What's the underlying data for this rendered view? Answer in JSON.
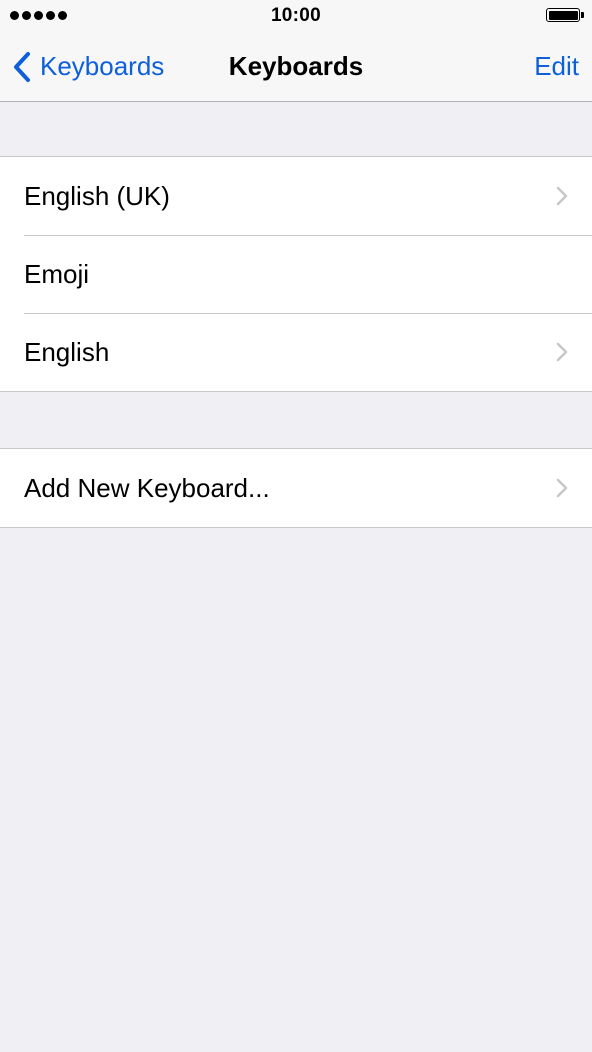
{
  "status_bar": {
    "signal_dots": 5,
    "time": "10:00",
    "battery_level": 1.0
  },
  "nav": {
    "back_label": "Keyboards",
    "title": "Keyboards",
    "edit_label": "Edit"
  },
  "sections": [
    {
      "rows": [
        {
          "label": "English (UK)",
          "chevron": true
        },
        {
          "label": "Emoji",
          "chevron": false
        },
        {
          "label": "English",
          "chevron": true
        }
      ]
    },
    {
      "rows": [
        {
          "label": "Add New Keyboard...",
          "chevron": true
        }
      ]
    }
  ],
  "icons": {
    "back": "chevron-left-icon",
    "disclosure": "chevron-right-icon"
  },
  "colors": {
    "tint": "#0e5fd9",
    "background": "#efeff4",
    "bar": "#f7f7f7",
    "separator": "#c8c7cc",
    "chevron": "#c7c7cc"
  }
}
